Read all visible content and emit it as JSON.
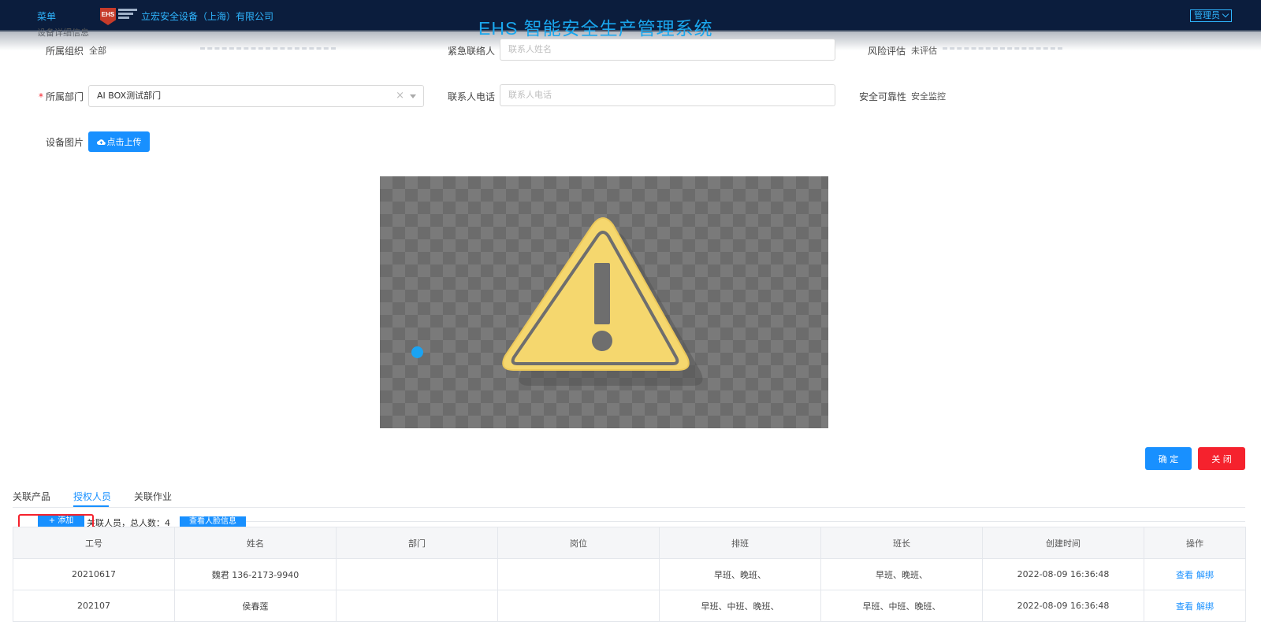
{
  "header": {
    "menu_label": "菜单",
    "logo_text": "EHS",
    "company": "立宏安全设备（上海）有限公司",
    "system_title": "EHS 智能安全生产管理系统",
    "user_menu": "管理员"
  },
  "form": {
    "section_title": "设备详细信息",
    "org_label": "所属组织",
    "org_value": "全部",
    "contact_label": "紧急联络人",
    "contact_placeholder": "联系人姓名",
    "risk_label": "风险评估",
    "risk_value": "未评估",
    "dept_label": "所属部门",
    "dept_value": "AI BOX测试部门",
    "phone_label": "联系人电话",
    "phone_placeholder": "联系人电话",
    "reliability_label": "安全可靠性",
    "reliability_value": "安全监控",
    "image_label": "设备图片",
    "upload_label": "点击上传"
  },
  "actions": {
    "confirm": "确 定",
    "close": "关 闭"
  },
  "tabs": [
    {
      "label": "关联产品"
    },
    {
      "label": "授权人员",
      "active": true
    },
    {
      "label": "关联作业"
    }
  ],
  "toolbar": {
    "add_label": "+ 添加",
    "related_text": "关联人员，总人数：4",
    "face_info_label": "查看人脸信息"
  },
  "table": {
    "columns": [
      "工号",
      "姓名",
      "部门",
      "岗位",
      "排班",
      "班长",
      "创建时间",
      "操作"
    ],
    "rows": [
      {
        "id": "20210617",
        "name": "魏君 136-2173-9940",
        "dept": "",
        "post": "",
        "shift": "早班、晚班、",
        "leader": "早班、晚班、",
        "created": "2022-08-09 16:36:48",
        "view": "查看",
        "unbind": "解绑"
      },
      {
        "id": "202107",
        "name": "侯春莲",
        "dept": "",
        "post": "",
        "shift": "早班、中班、晚班、",
        "leader": "早班、中班、晚班、",
        "created": "2022-08-09 16:36:48",
        "view": "查看",
        "unbind": "解绑"
      }
    ]
  },
  "colors": {
    "topbar": "#0b1d3d",
    "accent": "#1890ff",
    "danger": "#f5222d",
    "warning_fill": "#f5d76e"
  },
  "icons": {
    "upload": "cloud-upload-icon",
    "preview": "warning-triangle-icon"
  }
}
